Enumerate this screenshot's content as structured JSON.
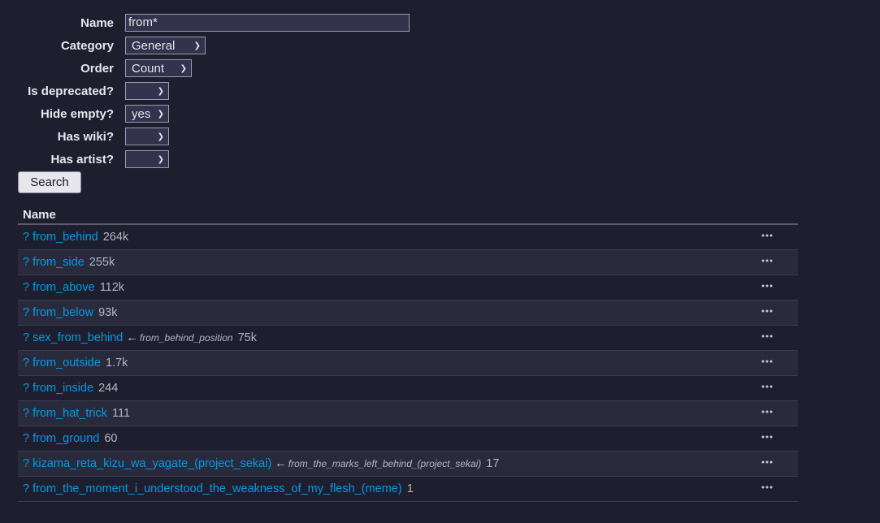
{
  "form": {
    "fields": [
      {
        "label": "Name",
        "type": "text",
        "value": "from*"
      },
      {
        "label": "Category",
        "type": "select",
        "value": "General"
      },
      {
        "label": "Order",
        "type": "select",
        "value": "Count"
      },
      {
        "label": "Is deprecated?",
        "type": "select",
        "value": ""
      },
      {
        "label": "Hide empty?",
        "type": "select",
        "value": "yes"
      },
      {
        "label": "Has wiki?",
        "type": "select",
        "value": ""
      },
      {
        "label": "Has artist?",
        "type": "select",
        "value": ""
      }
    ],
    "search_label": "Search"
  },
  "table": {
    "header": "Name",
    "rows": [
      {
        "q": "?",
        "name": "from_behind",
        "alias": "",
        "count": "264k"
      },
      {
        "q": "?",
        "name": "from_side",
        "alias": "",
        "count": "255k"
      },
      {
        "q": "?",
        "name": "from_above",
        "alias": "",
        "count": "112k"
      },
      {
        "q": "?",
        "name": "from_below",
        "alias": "",
        "count": "93k"
      },
      {
        "q": "?",
        "name": "sex_from_behind",
        "alias": "from_behind_position",
        "count": "75k"
      },
      {
        "q": "?",
        "name": "from_outside",
        "alias": "",
        "count": "1.7k"
      },
      {
        "q": "?",
        "name": "from_inside",
        "alias": "",
        "count": "244"
      },
      {
        "q": "?",
        "name": "from_hat_trick",
        "alias": "",
        "count": "111"
      },
      {
        "q": "?",
        "name": "from_ground",
        "alias": "",
        "count": "60"
      },
      {
        "q": "?",
        "name": "kizama_reta_kizu_wa_yagate_(project_sekai)",
        "alias": "from_the_marks_left_behind_(project_sekai)",
        "count": "17"
      },
      {
        "q": "?",
        "name": "from_the_moment_i_understood_the_weakness_of_my_flesh_(meme)",
        "alias": "",
        "count": "1"
      }
    ],
    "alias_arrow": "←",
    "more_icon": "ellipsis-icon"
  },
  "colors": {
    "background": "#1f1e2e",
    "link": "#009be6",
    "row_alt": "#2a2a3d"
  }
}
